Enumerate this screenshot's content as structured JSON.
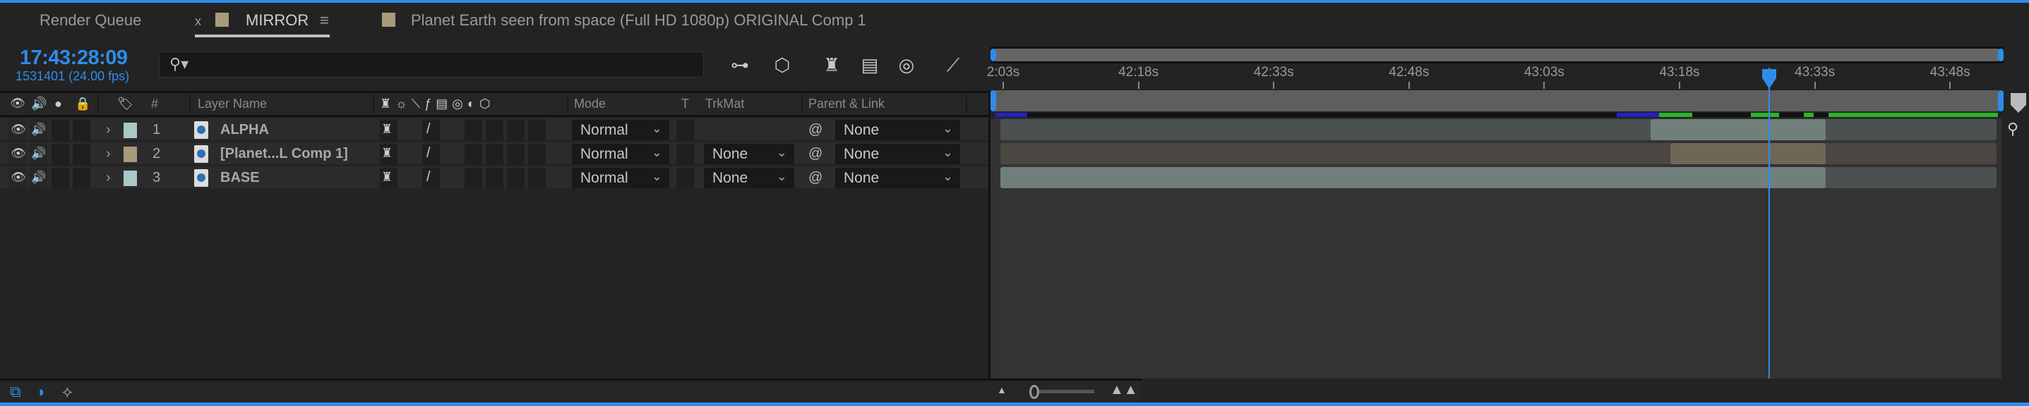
{
  "tabs": [
    {
      "label": "Render Queue"
    },
    {
      "label": "MIRROR",
      "close": "x",
      "menu": "≡",
      "color": "#a99a7c",
      "active": true
    },
    {
      "label": "Planet Earth seen from space (Full HD 1080p) ORIGINAL Comp 1",
      "color": "#a99a7c"
    }
  ],
  "time": {
    "timecode": "17:43:28:09",
    "frame_fps": "1531401 (24.00 fps)"
  },
  "search": {
    "placeholder": ""
  },
  "columns": {
    "hash": "#",
    "layer_name": "Layer Name",
    "mode": "Mode",
    "t": "T",
    "trkmat": "TrkMat",
    "parent": "Parent & Link"
  },
  "layers": [
    {
      "num": "1",
      "name": "ALPHA",
      "color": "#a9c9c6",
      "mode": "Normal",
      "trkmat": "",
      "parent": "None"
    },
    {
      "num": "2",
      "name": "[Planet...L Comp 1]",
      "color": "#a99a7c",
      "mode": "Normal",
      "trkmat": "None",
      "parent": "None"
    },
    {
      "num": "3",
      "name": "BASE",
      "color": "#a9c9c6",
      "mode": "Normal",
      "trkmat": "None",
      "parent": "None"
    }
  ],
  "ruler": [
    "2:03s",
    "42:18s",
    "42:33s",
    "42:48s",
    "43:03s",
    "43:18s",
    "43:33s",
    "43:48s"
  ],
  "colors": {
    "accent": "#2d8ceb"
  }
}
